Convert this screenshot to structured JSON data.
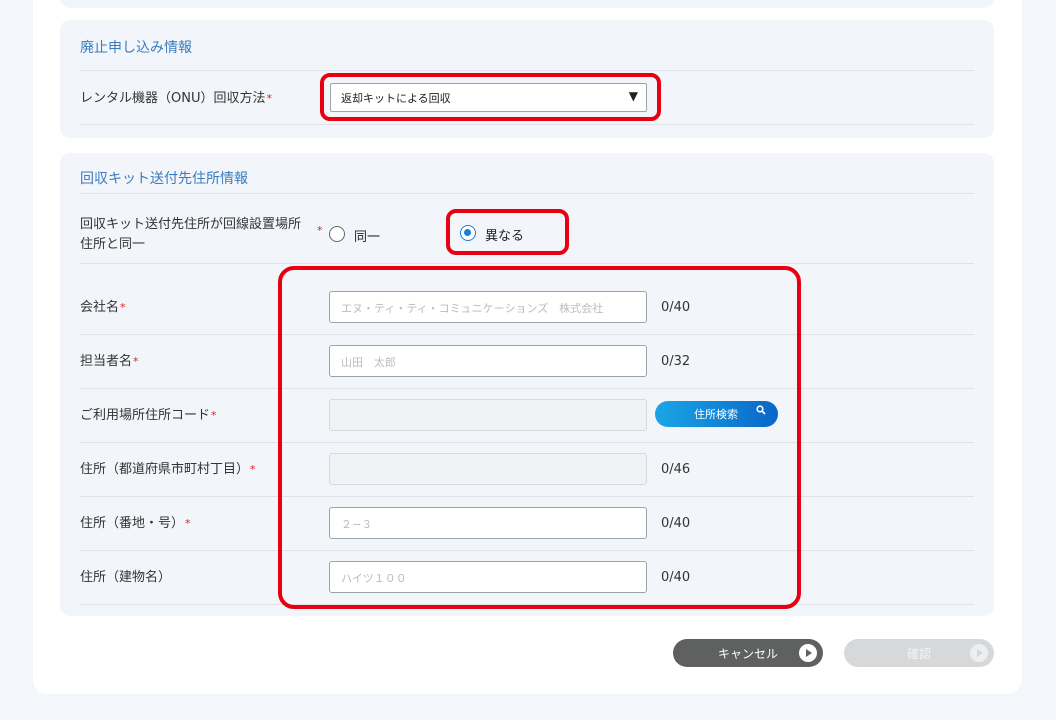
{
  "sections": {
    "cancellation_title": "廃止申し込み情報",
    "kit_address_title": "回収キット送付先住所情報"
  },
  "rental_return": {
    "label": "レンタル機器（ONU）回収方法",
    "required_mark": "*",
    "selected_value": "返却キットによる回収"
  },
  "same_address": {
    "label_line1": "回収キット送付先住所が回線設置場所",
    "label_line2": "住所と同一",
    "required_mark": "*",
    "options": [
      "同一",
      "異なる"
    ],
    "selected": "異なる"
  },
  "fields": {
    "company": {
      "label": "会社名",
      "required_mark": "*",
      "placeholder": "エヌ・ティ・ティ・コミュニケーションズ　株式会社",
      "counter": "0/40"
    },
    "person": {
      "label": "担当者名",
      "required_mark": "*",
      "placeholder": "山田　太郎",
      "counter": "0/32"
    },
    "postal": {
      "label": "ご利用場所住所コード",
      "required_mark": "*",
      "search_button": "住所検索"
    },
    "pref": {
      "label": "住所（都道府県市町村丁目）",
      "required_mark": "*",
      "counter": "0/46"
    },
    "street": {
      "label": "住所（番地・号）",
      "required_mark": "*",
      "placeholder": "２−３",
      "counter": "0/40"
    },
    "building": {
      "label": "住所（建物名）",
      "placeholder": "ハイツ１００",
      "counter": "0/40"
    }
  },
  "buttons": {
    "cancel": "キャンセル",
    "confirm": "確認"
  },
  "icons": {
    "dropdown": "caret-down-icon",
    "search": "magnifier-icon",
    "button_arrow": "play-circle-icon"
  },
  "colors": {
    "accent": "#3b7bbf",
    "radio_selected": "#1a7fd4",
    "required": "#e02020",
    "highlight": "#e60012"
  }
}
